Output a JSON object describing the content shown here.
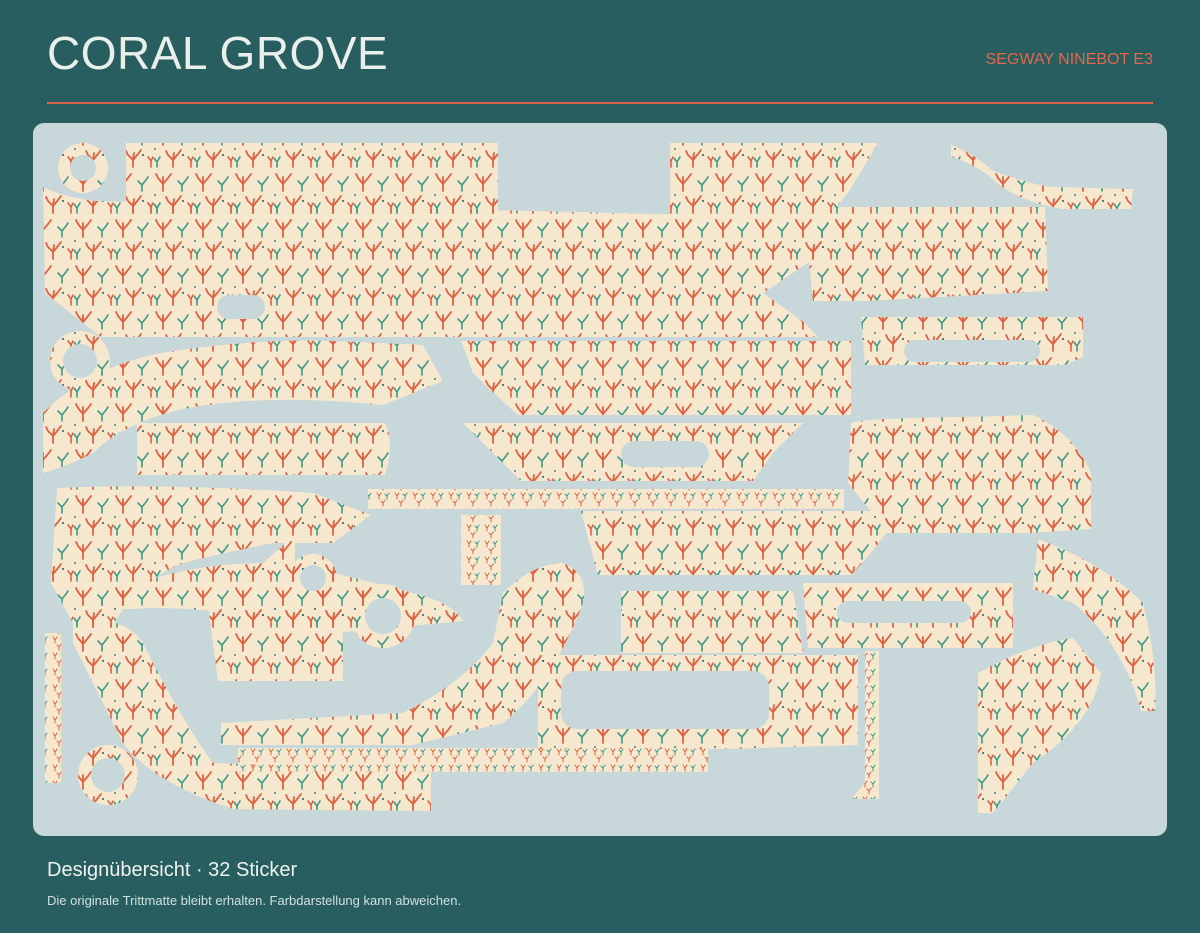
{
  "header": {
    "title": "CORAL GROVE",
    "model": "SEGWAY NINEBOT E3"
  },
  "footer": {
    "overview": "Designübersicht · 32 Sticker",
    "note": "Die originale Trittmatte bleibt erhalten. Farbdarstellung kann abweichen."
  },
  "colors": {
    "background": "#285e60",
    "sheet": "#c8d8da",
    "sticker": "#f6e7cf",
    "coral_red": "#e2603f",
    "coral_green": "#3e9a86",
    "accent_rule": "#d9644a"
  },
  "sticker_count": 32
}
